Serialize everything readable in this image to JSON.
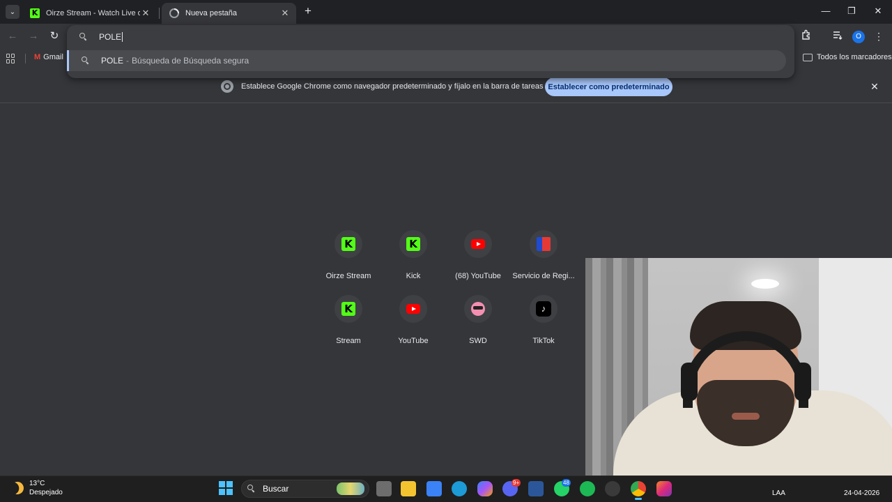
{
  "tabs": [
    {
      "title": "Oirze Stream - Watch Live on Kick",
      "favicon": "kick-icon",
      "active": false
    },
    {
      "title": "Nueva pestaña",
      "favicon": "chrome-loading-icon",
      "active": true
    }
  ],
  "tab_close_glyph": "✕",
  "new_tab_glyph": "+",
  "omnibox": {
    "value": "POLE",
    "suggestion": {
      "query": "POLE",
      "separator": "-",
      "description": "Búsqueda de Búsqueda segura"
    }
  },
  "bookmarks": {
    "items": [
      {
        "label": "Gmail",
        "icon": "gmail-icon"
      }
    ],
    "all_bookmarks_label": "Todos los marcadores"
  },
  "profile_initial": "O",
  "infobar": {
    "message": "Establece Google Chrome como navegador predeterminado y fíjalo en la barra de tareas",
    "button_label": "Establecer como predeterminado",
    "close_glyph": "✕"
  },
  "shortcuts": [
    {
      "label": "Oirze Stream",
      "icon": "kick-icon"
    },
    {
      "label": "Kick",
      "icon": "kick-icon"
    },
    {
      "label": "(68) YouTube",
      "icon": "youtube-icon"
    },
    {
      "label": "Servicio de Regi...",
      "icon": "registro-civil-icon"
    },
    {
      "label": "Stream",
      "icon": "kick-icon"
    },
    {
      "label": "YouTube",
      "icon": "youtube-icon"
    },
    {
      "label": "SWD",
      "icon": "swd-icon"
    },
    {
      "label": "TikTok",
      "icon": "tiktok-icon"
    }
  ],
  "taskbar": {
    "weather": {
      "temp": "13°C",
      "condition": "Despejado"
    },
    "search_label": "Buscar",
    "discord_badge": "9+",
    "whatsapp_badge": "48",
    "language": "LAA",
    "date": "24-04-2026"
  },
  "colors": {
    "accent": "#a8c7fa",
    "kick_green": "#53fc18",
    "youtube_red": "#ff0000",
    "page_bg": "#35363a",
    "tabstrip_bg": "#202124"
  }
}
